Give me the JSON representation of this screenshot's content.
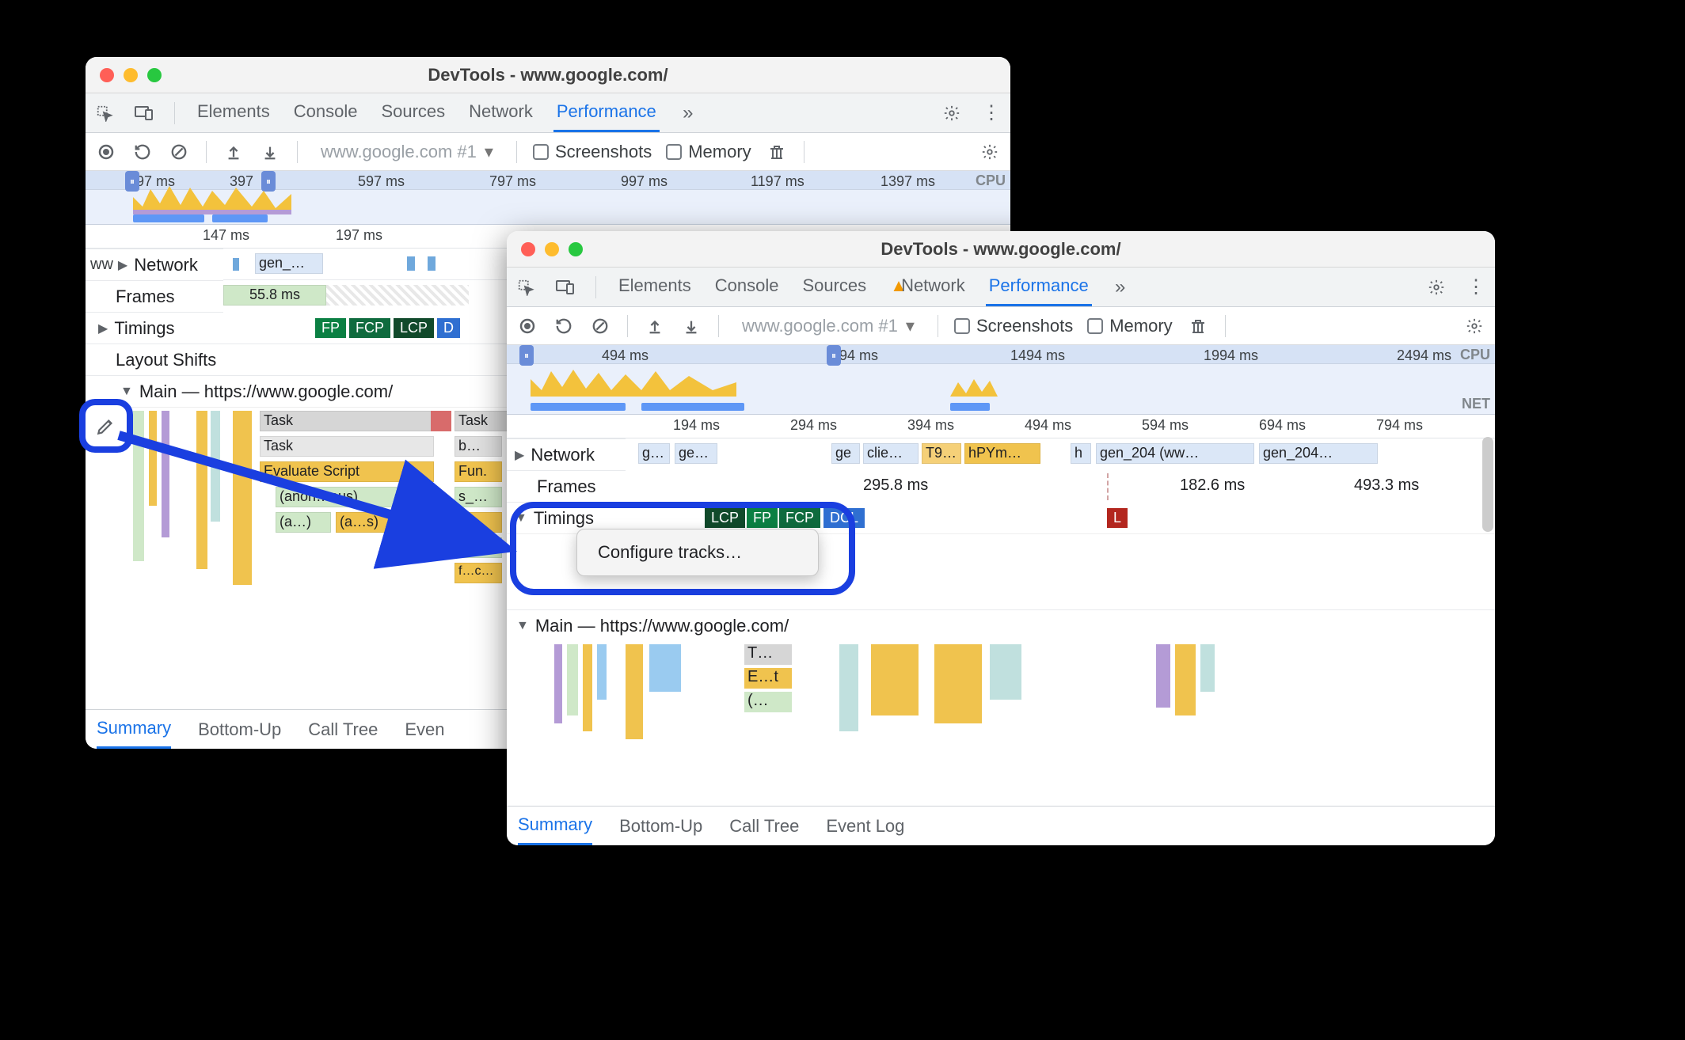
{
  "window1": {
    "title": "DevTools - www.google.com/",
    "tabs": [
      "Elements",
      "Console",
      "Sources",
      "Network",
      "Performance"
    ],
    "activeTab": "Performance",
    "urlSelect": "www.google.com #1",
    "chk1": "Screenshots",
    "chk2": "Memory",
    "ruler": [
      "97 ms",
      "397",
      "597 ms",
      "797 ms",
      "997 ms",
      "1197 ms",
      "1397 ms"
    ],
    "cpuLabel": "CPU",
    "ruler2": [
      "147 ms",
      "197 ms"
    ],
    "tracks": {
      "network": "Network",
      "networkItems": [
        "ww",
        "gen_…"
      ],
      "frames": "Frames",
      "framesVal": "55.8 ms",
      "timings": "Timings",
      "timingPills": [
        "FP",
        "FCP",
        "LCP",
        "D"
      ],
      "layoutShifts": "Layout Shifts",
      "main": "Main — https://www.google.com/",
      "rows": {
        "task": "Task",
        "task2": "Task",
        "taskR": "Task",
        "eval": "Evaluate Script",
        "fun": "Fun.",
        "anon": "(anon…ous)",
        "a1": "(a…)",
        "a2": "(a…s)",
        "s": "s_…",
        "dots": "…",
        "ac": "(a…c…",
        "fc": "f…c…"
      }
    },
    "bottomTabs": [
      "Summary",
      "Bottom-Up",
      "Call Tree",
      "Even"
    ]
  },
  "window2": {
    "title": "DevTools - www.google.com/",
    "tabs": [
      "Elements",
      "Console",
      "Sources",
      "Network",
      "Performance"
    ],
    "networkWarn": true,
    "activeTab": "Performance",
    "urlSelect": "www.google.com #1",
    "chk1": "Screenshots",
    "chk2": "Memory",
    "ruler": [
      "494 ms",
      "94 ms",
      "1494 ms",
      "1994 ms",
      "2494 ms"
    ],
    "cpuLabel": "CPU",
    "netLabel": "NET",
    "ruler2": [
      "194 ms",
      "294 ms",
      "394 ms",
      "494 ms",
      "594 ms",
      "694 ms",
      "794 ms"
    ],
    "tracks": {
      "network": "Network",
      "networkItems": [
        "g…",
        "ge…",
        "ge",
        "clie…",
        "T9…",
        "hPYm…",
        "h",
        "gen_204 (ww…",
        "gen_204…"
      ],
      "frames": "Frames",
      "framesVals": [
        "295.8 ms",
        "182.6 ms",
        "493.3 ms"
      ],
      "timings": "Timings",
      "timingPills": [
        "LCP",
        "FP",
        "FCP",
        "DCL"
      ],
      "lBadge": "L",
      "main": "Main — https://www.google.com/",
      "rows": {
        "t": "T…",
        "e": "E…t",
        "p": "(…"
      }
    },
    "contextMenu": "Configure tracks…",
    "bottomTabs": [
      "Summary",
      "Bottom-Up",
      "Call Tree",
      "Event Log"
    ]
  }
}
